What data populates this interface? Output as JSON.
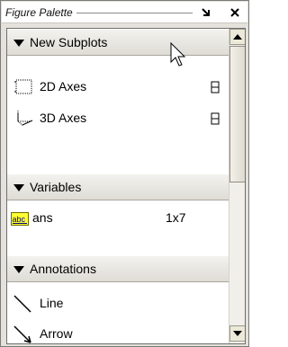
{
  "window": {
    "title": "Figure Palette"
  },
  "sections": {
    "new_subplots": {
      "label": "New Subplots",
      "items": [
        {
          "label": "2D Axes",
          "icon": "axes-2d-icon"
        },
        {
          "label": "3D Axes",
          "icon": "axes-3d-icon"
        }
      ]
    },
    "variables": {
      "label": "Variables",
      "items": [
        {
          "name": "ans",
          "size": "1x7",
          "icon": "abc-variable-icon"
        }
      ]
    },
    "annotations": {
      "label": "Annotations",
      "items": [
        {
          "label": "Line",
          "icon": "line-icon"
        },
        {
          "label": "Arrow",
          "icon": "arrow-icon"
        }
      ]
    }
  },
  "colors": {
    "header_gradient_top": "#f3f2ee",
    "header_gradient_bottom": "#dedcd5",
    "variable_icon_bg": "#ffff33"
  }
}
